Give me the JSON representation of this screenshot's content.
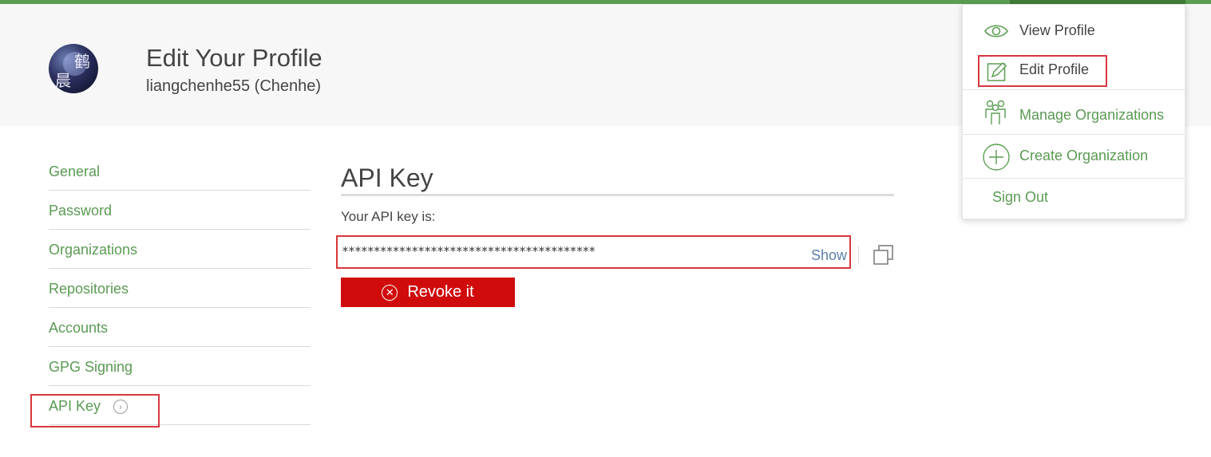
{
  "header": {
    "title": "Edit Your Profile",
    "user": "liangchenhe55 (Chenhe)",
    "avatar_chars": [
      "鹤",
      "晨"
    ]
  },
  "sidebar": {
    "items": [
      {
        "label": "General"
      },
      {
        "label": "Password"
      },
      {
        "label": "Organizations"
      },
      {
        "label": "Repositories"
      },
      {
        "label": "Accounts"
      },
      {
        "label": "GPG Signing"
      },
      {
        "label": "API Key",
        "active": true
      }
    ]
  },
  "main": {
    "section_title": "API Key",
    "key_label": "Your API key is:",
    "key_value": "****************************************",
    "show_label": "Show",
    "revoke_label": "Revoke it"
  },
  "menu": {
    "view_profile": "View Profile",
    "edit_profile": "Edit Profile",
    "manage_orgs": "Manage Organizations",
    "create_org": "Create Organization",
    "sign_out": "Sign Out"
  },
  "colors": {
    "accent_green": "#5b9e52",
    "danger_red": "#d00b0b",
    "highlight_red": "#d9363e",
    "link_blue": "#5b7fa8"
  },
  "icons": [
    "eye-icon",
    "pencil-icon",
    "people-icon",
    "plus-circle-icon",
    "chevron-right-icon",
    "copy-icon",
    "x-circle-icon"
  ]
}
